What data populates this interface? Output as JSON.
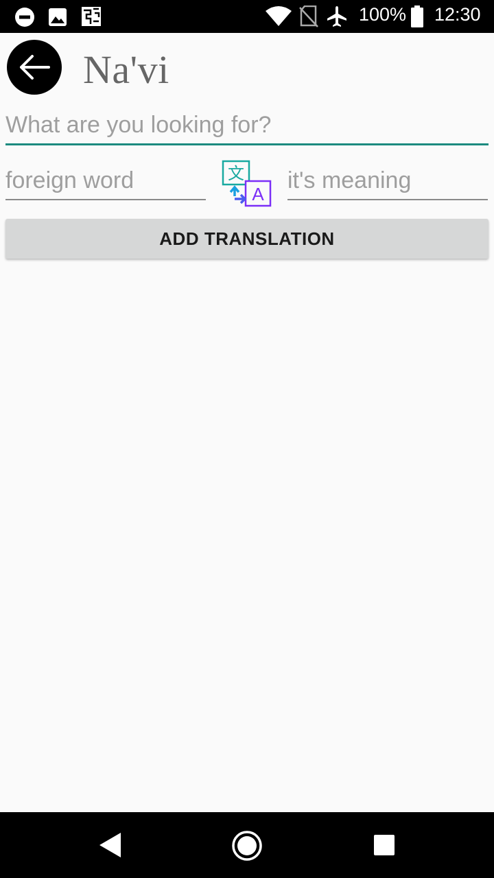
{
  "status_bar": {
    "battery_percent": "100%",
    "time": "12:30",
    "icons": [
      "do-not-disturb-icon",
      "image-icon",
      "notification-icon",
      "wifi-icon",
      "no-sim-icon",
      "airplane-icon",
      "battery-icon"
    ]
  },
  "app_bar": {
    "title": "Na'vi",
    "back_icon": "arrow-left-icon"
  },
  "search": {
    "placeholder": "What are you looking for?",
    "value": "",
    "accent_color": "#1b8a7f"
  },
  "translation_form": {
    "foreign_placeholder": "foreign word",
    "meaning_placeholder": "it's meaning",
    "swap_icon": "translate-icon",
    "add_button_label": "ADD TRANSLATION"
  },
  "nav_bar": {
    "icons": [
      "back-triangle-icon",
      "home-circle-icon",
      "recents-square-icon"
    ]
  }
}
